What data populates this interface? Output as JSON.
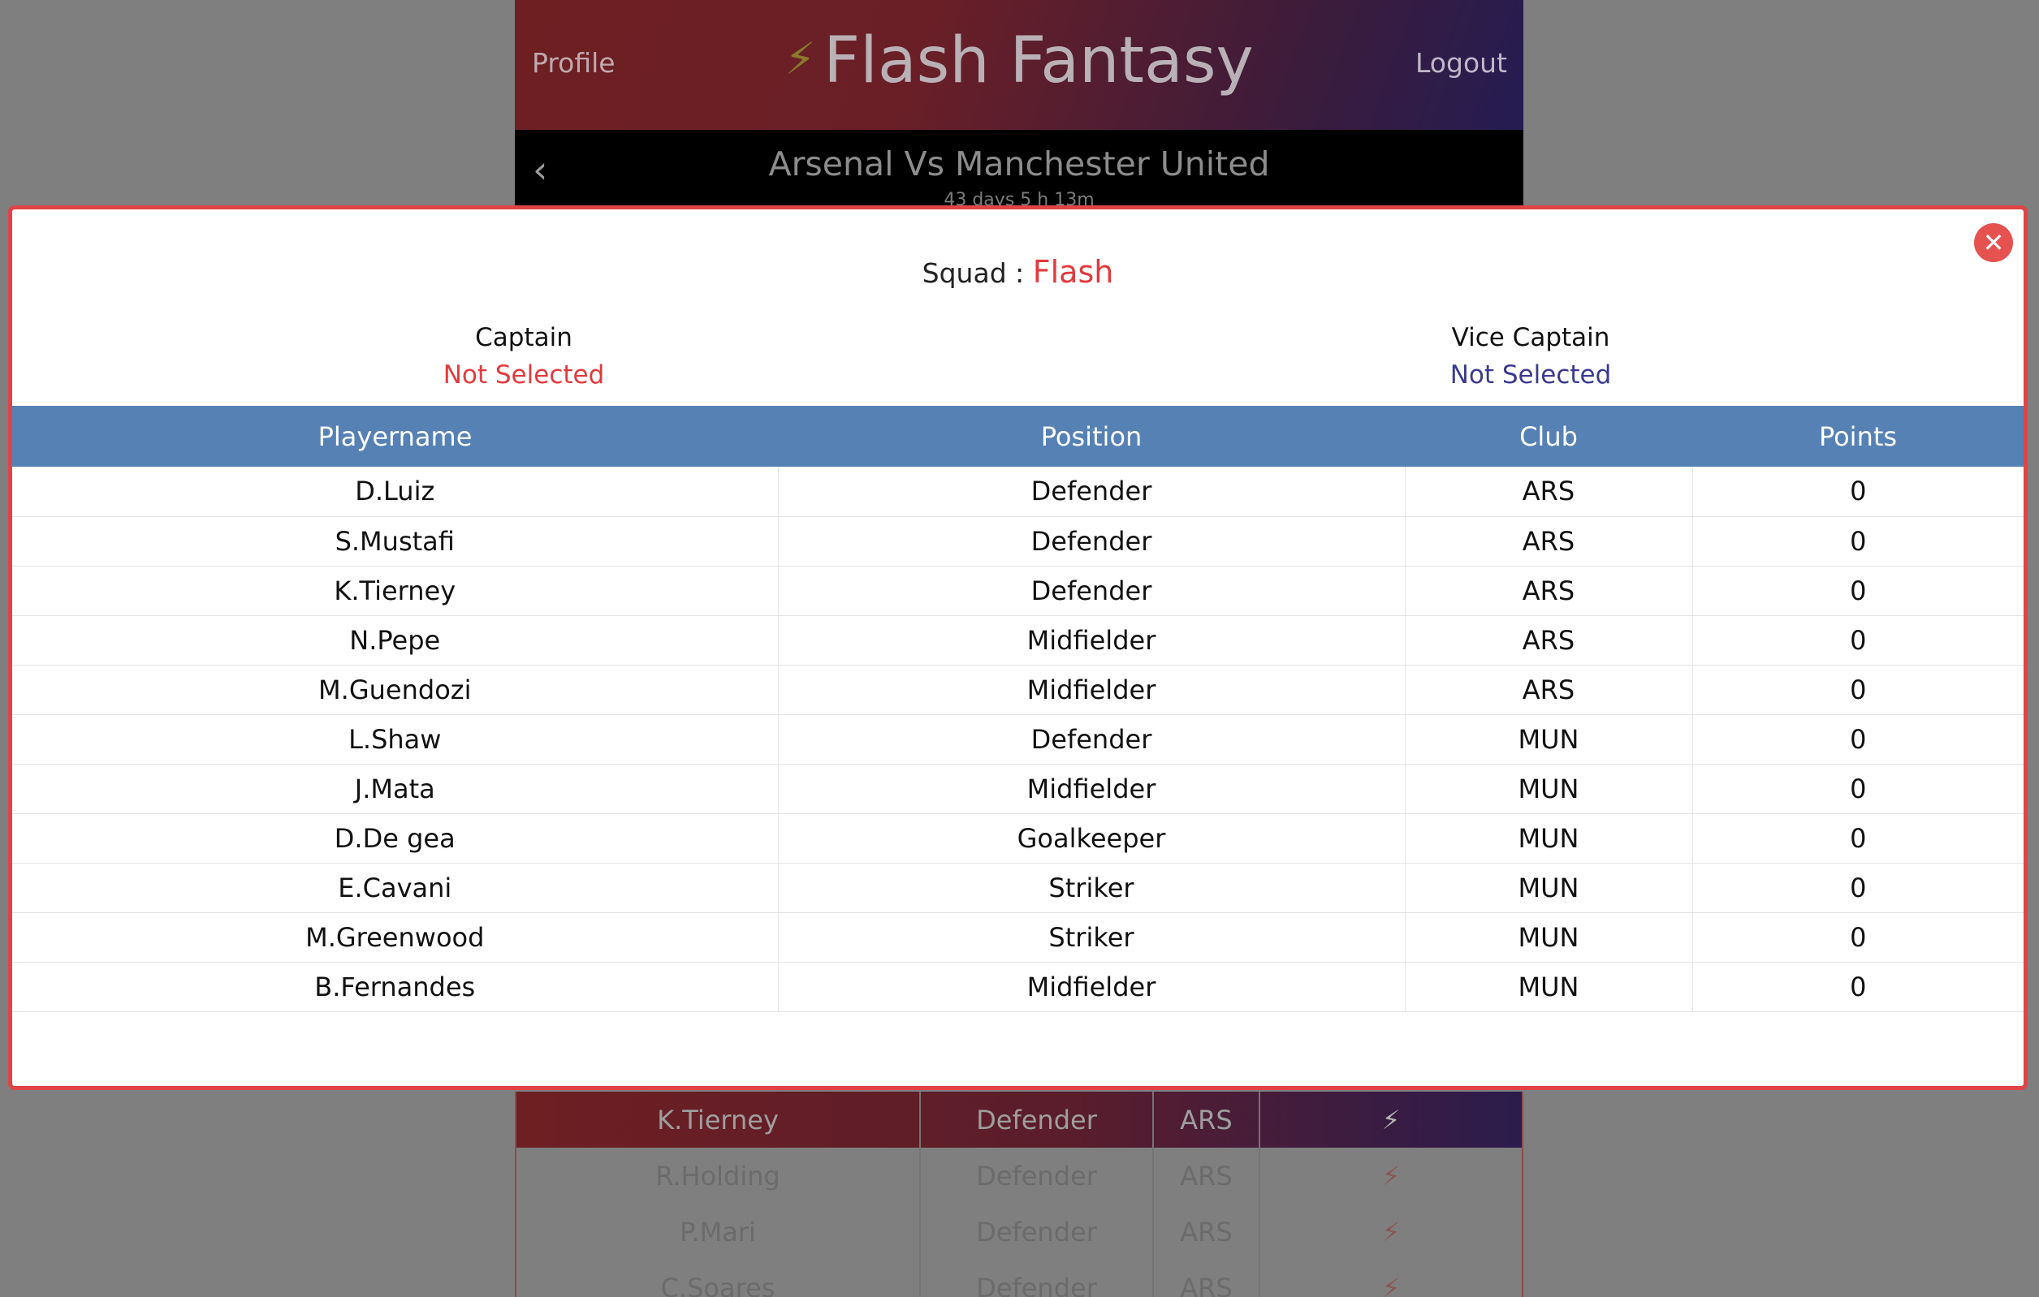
{
  "header": {
    "profile_label": "Profile",
    "brand_icon": "bolt-icon",
    "brand": "Flash Fantasy",
    "logout_label": "Logout"
  },
  "match": {
    "title": "Arsenal Vs Manchester United",
    "countdown": "43 days 5 h 13m"
  },
  "background_list": [
    {
      "name": "K.Tierney",
      "position": "Defender",
      "club": "ARS",
      "selected": true
    },
    {
      "name": "R.Holding",
      "position": "Defender",
      "club": "ARS",
      "selected": false
    },
    {
      "name": "P.Mari",
      "position": "Defender",
      "club": "ARS",
      "selected": false
    },
    {
      "name": "C.Soares",
      "position": "Defender",
      "club": "ARS",
      "selected": false
    }
  ],
  "modal": {
    "squad_label": "Squad :",
    "squad_name": "Flash",
    "captain_label": "Captain",
    "captain_value": "Not Selected",
    "vice_captain_label": "Vice Captain",
    "vice_captain_value": "Not Selected",
    "columns": [
      "Playername",
      "Position",
      "Club",
      "Points"
    ],
    "rows": [
      [
        "D.Luiz",
        "Defender",
        "ARS",
        "0"
      ],
      [
        "S.Mustafi",
        "Defender",
        "ARS",
        "0"
      ],
      [
        "K.Tierney",
        "Defender",
        "ARS",
        "0"
      ],
      [
        "N.Pepe",
        "Midfielder",
        "ARS",
        "0"
      ],
      [
        "M.Guendozi",
        "Midfielder",
        "ARS",
        "0"
      ],
      [
        "L.Shaw",
        "Defender",
        "MUN",
        "0"
      ],
      [
        "J.Mata",
        "Midfielder",
        "MUN",
        "0"
      ],
      [
        "D.De gea",
        "Goalkeeper",
        "MUN",
        "0"
      ],
      [
        "E.Cavani",
        "Striker",
        "MUN",
        "0"
      ],
      [
        "M.Greenwood",
        "Striker",
        "MUN",
        "0"
      ],
      [
        "B.Fernandes",
        "Midfielder",
        "MUN",
        "0"
      ]
    ]
  },
  "colors": {
    "accent_red": "#e13a3e",
    "accent_indigo": "#3b3a8f",
    "table_header": "#5581b5"
  }
}
